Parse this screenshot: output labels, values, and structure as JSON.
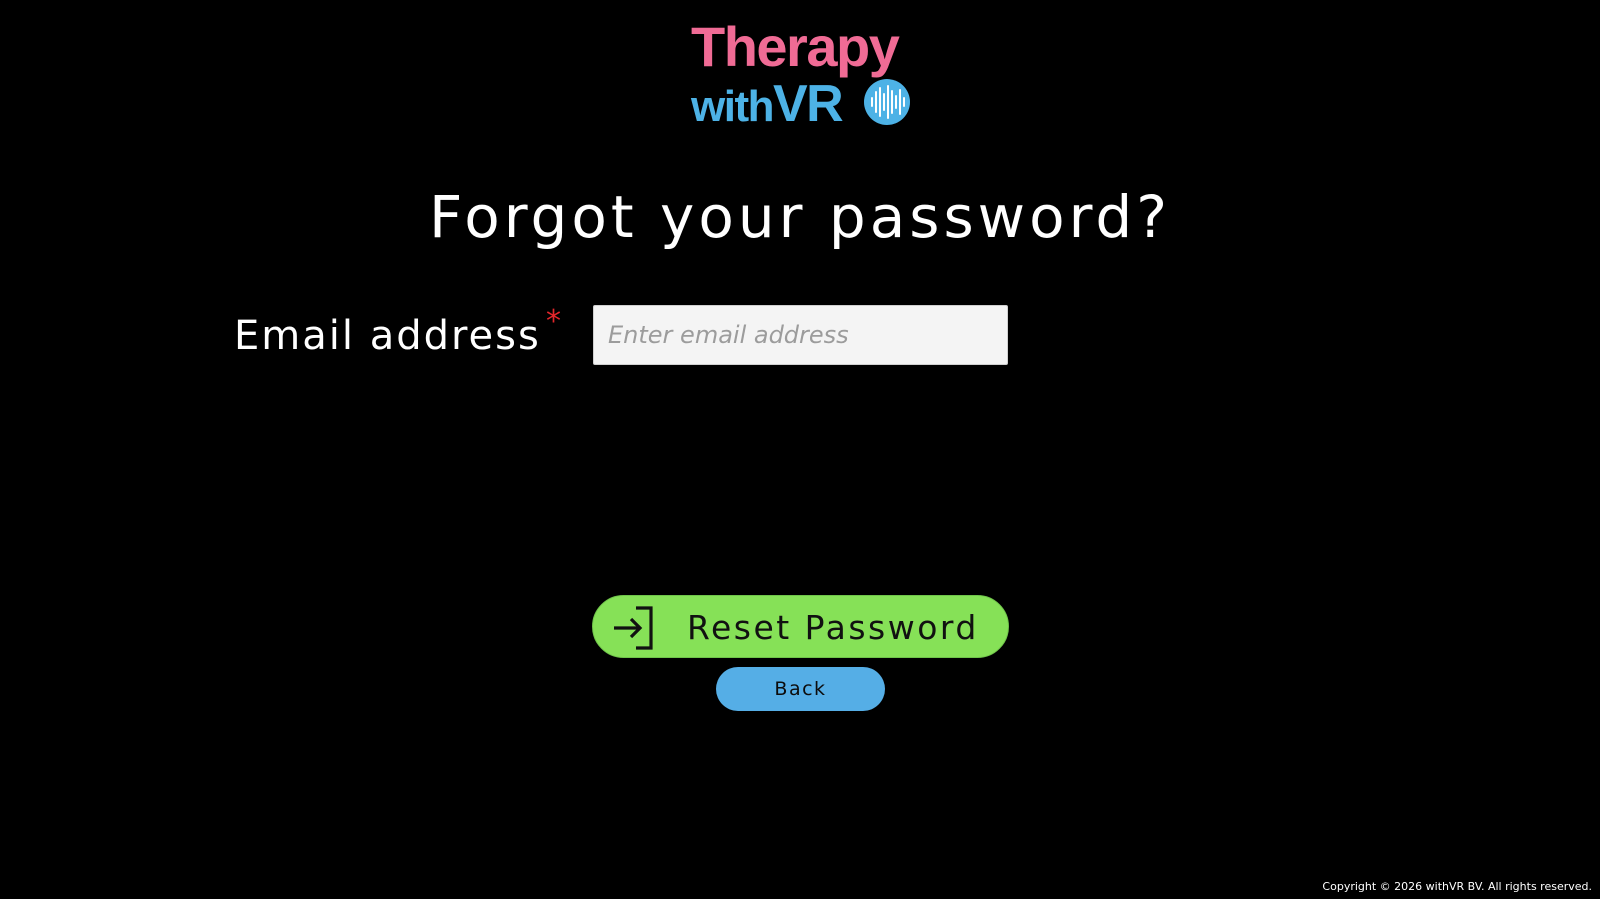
{
  "logo": {
    "line1": "Therapy",
    "line2_prefix": "with",
    "line2_suffix": "VR",
    "badge_icon": "soundwave-circle-icon",
    "colors": {
      "primary": "#f06b95",
      "secondary": "#4db2e6"
    }
  },
  "page": {
    "title": "Forgot your password?"
  },
  "form": {
    "email_label": "Email address",
    "required_mark": "*",
    "email_value": "",
    "email_placeholder": "Enter email address"
  },
  "actions": {
    "reset_label": "Reset Password",
    "reset_icon": "login-arrow-icon",
    "back_label": "Back"
  },
  "footer": {
    "copyright": "Copyright © 2026 withVR BV. All rights reserved."
  },
  "colors": {
    "background": "#000000",
    "reset_button": "#86e157",
    "back_button": "#55aee6",
    "required": "#e3262b"
  }
}
